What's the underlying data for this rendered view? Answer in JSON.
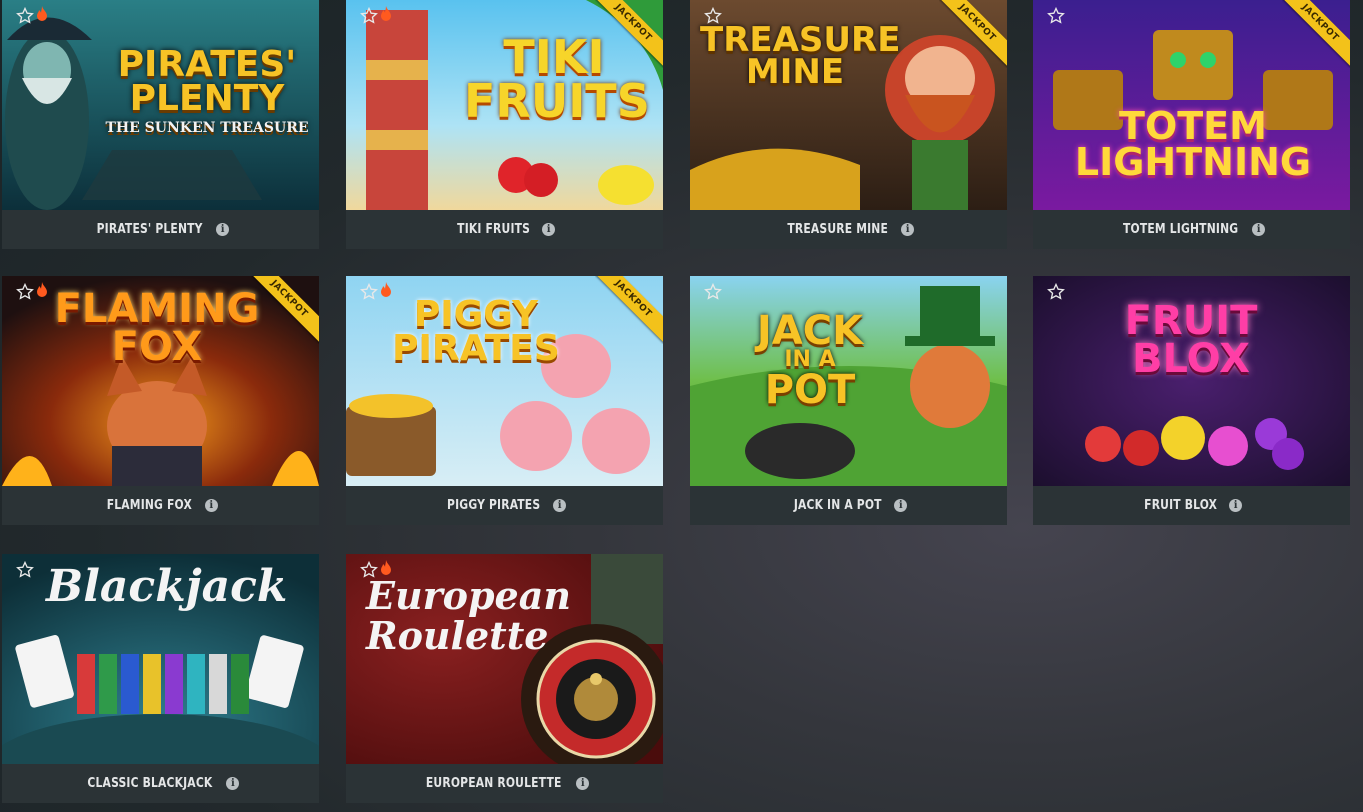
{
  "jackpot_badge": "JACKPOT",
  "games": [
    {
      "name": "PIRATES' PLENTY",
      "logo": [
        "PIRATES'",
        "PLENTY"
      ],
      "logo_sub": "THE SUNKEN TREASURE",
      "jackpot": false,
      "hot": true,
      "favorite_icon": "star-outline-icon"
    },
    {
      "name": "TIKI FRUITS",
      "logo": [
        "TIKI",
        "FRUITS"
      ],
      "jackpot": true,
      "hot": true,
      "favorite_icon": "star-outline-icon"
    },
    {
      "name": "TREASURE MINE",
      "logo": [
        "TREASURE",
        "MINE"
      ],
      "jackpot": true,
      "hot": false,
      "favorite_icon": "star-outline-icon"
    },
    {
      "name": "TOTEM LIGHTNING",
      "logo": [
        "TOTEM",
        "LIGHTNING"
      ],
      "jackpot": true,
      "hot": false,
      "favorite_icon": "star-outline-icon"
    },
    {
      "name": "FLAMING FOX",
      "logo": [
        "FLAMING",
        "FOX"
      ],
      "jackpot": true,
      "hot": true,
      "favorite_icon": "star-outline-icon"
    },
    {
      "name": "PIGGY PIRATES",
      "logo": [
        "PIGGY",
        "PIRATES"
      ],
      "jackpot": true,
      "hot": true,
      "favorite_icon": "star-outline-icon"
    },
    {
      "name": "JACK IN A POT",
      "logo": [
        "JACK",
        "IN A",
        "POT"
      ],
      "jackpot": false,
      "hot": false,
      "favorite_icon": "star-outline-icon"
    },
    {
      "name": "FRUIT BLOX",
      "logo": [
        "FRUIT",
        "BLOX"
      ],
      "jackpot": false,
      "hot": false,
      "favorite_icon": "star-outline-icon"
    },
    {
      "name": "CLASSIC BLACKJACK",
      "logo": [
        "Blackjack"
      ],
      "jackpot": false,
      "hot": false,
      "favorite_icon": "star-outline-icon"
    },
    {
      "name": "EUROPEAN ROULETTE",
      "logo": [
        "European",
        "Roulette"
      ],
      "jackpot": false,
      "hot": true,
      "favorite_icon": "star-outline-icon"
    }
  ],
  "info_icon": "i",
  "colors": {
    "background": "#22292c",
    "caption_bg": "#2b3336",
    "caption_text": "#e4e6e7",
    "jackpot_ribbon": "#f3c21a",
    "logo_gold": "#f7c326"
  }
}
